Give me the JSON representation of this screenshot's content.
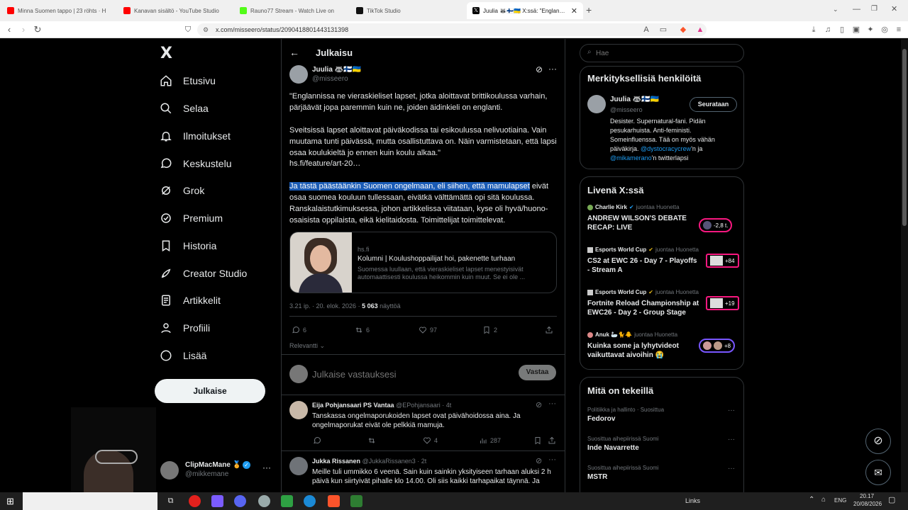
{
  "browser": {
    "tabs": [
      {
        "title": "Minna Suomen tappo | 23 röhts · H",
        "favicon_color": "#ff0000",
        "active": false
      },
      {
        "title": "Kanavan sisältö - YouTube Studio",
        "favicon_color": "#ff0000",
        "active": false
      },
      {
        "title": "Rauno77 Stream - Watch Live on",
        "favicon_color": "#53fc18",
        "active": false
      },
      {
        "title": "TikTok Studio",
        "favicon_color": "#111111",
        "active": false
      },
      {
        "title": "Juulia 🦝🇫🇮🇺🇦 X:ssä: \"Englanniss",
        "favicon_color": "#000000",
        "active": true
      }
    ],
    "new_tab": "+",
    "url": "x.com/misseero/status/2090418801443131398"
  },
  "nav": {
    "logo": "X",
    "items": [
      {
        "label": "Etusivu",
        "icon": "home-icon"
      },
      {
        "label": "Selaa",
        "icon": "search-icon"
      },
      {
        "label": "Ilmoitukset",
        "icon": "bell-icon"
      },
      {
        "label": "Keskustelu",
        "icon": "message-icon"
      },
      {
        "label": "Grok",
        "icon": "grok-icon"
      },
      {
        "label": "Premium",
        "icon": "verified-icon"
      },
      {
        "label": "Historia",
        "icon": "bookmark-icon"
      },
      {
        "label": "Creator Studio",
        "icon": "rocket-icon"
      },
      {
        "label": "Artikkelit",
        "icon": "article-icon"
      },
      {
        "label": "Profiili",
        "icon": "person-icon"
      },
      {
        "label": "Lisää",
        "icon": "more-icon"
      }
    ],
    "post_button": "Julkaise",
    "account": {
      "name": "ClipMacMane 🏅",
      "handle": "@mikkemane",
      "more": "···"
    }
  },
  "main": {
    "header": "Julkaisu",
    "tweet": {
      "name": "Juulia 🦝🇫🇮🇺🇦",
      "handle": "@misseero",
      "para1": "\"Englannissa ne vieraskieliset lapset, jotka aloittavat brittikoulussa varhain, pärjäävät jopa paremmin kuin ne, joiden äidinkieli on englanti.",
      "para2": "Sveitsissä lapset aloittavat päiväkodissa tai esikoulussa nelivuotiaina. Vain muutama tunti päivässä, mutta osallistuttava on. Näin varmistetaan, että lapsi osaa koulukieltä jo ennen kuin koulu alkaa.\"",
      "link": "hs.fi/feature/art-20…",
      "para3_highlight": "Ja tästä päästäänkin Suomen ongelmaan, eli siihen, että mamulapset",
      "para3_rest": " eivät osaa suomea kouluun tullessaan, eivätkä välttämättä opi sitä koulussa. Ranskalaistutkimuksessa, johon artikkelissa viitataan, kyse oli hyvä/huono-osaisista oppilaista, eikä kielitaidosta. Toimittelijat toimittelevat.",
      "card": {
        "domain": "hs.fi",
        "title": "Kolumni | Koulushoppailijat hoi, pakenette turhaan",
        "desc": "Suomessa luullaan, että vieraskieliset lapset menestyisivät automaattisesti koulussa heikommin kuin muut. Se ei ole ..."
      },
      "meta_time": "3.21 ip. · 20. elok. 2026 · ",
      "meta_views": "5 063",
      "meta_views_label": " näyttöä",
      "stats": {
        "replies": "6",
        "reposts": "6",
        "likes": "97",
        "bookmarks": "2"
      },
      "sort_label": "Relevantti"
    },
    "reply_box": {
      "placeholder": "Julkaise vastauksesi",
      "button": "Vastaa"
    },
    "replies": [
      {
        "name": "Eija Pohjansaari PS Vantaa",
        "handle": "@EPohjansaari",
        "time": "· 4t",
        "text": "Tanskassa ongelmaporukoiden lapset ovat päivähoidossa aina. Ja ongelmaporukat eivät ole pelkkiä mamuja.",
        "likes": "4",
        "views": "287"
      },
      {
        "name": "Jukka Rissanen",
        "handle": "@JukkaRissanen3",
        "time": "· 2t",
        "text": "Meille tuli ummikko 6 veenä. Sain kuin sainkin yksityiseen tarhaan aluksi 2 h päivä kun siirtyivät pihalle klo 14.00. Oli siis kaikki tarhapaikat täynnä. Ja"
      }
    ]
  },
  "sidebar": {
    "search_placeholder": "Hae",
    "relevant": {
      "title": "Merkityksellisiä henkilöitä",
      "name": "Juulia 🦝🇫🇮🇺🇦",
      "handle": "@misseero",
      "follow": "Seurataan",
      "bio1": "Desister. Supernatural-fani. Pidän pesukarhuista. Anti-feministi. Someinfluenssa. Tää on myös vähän päiväkirja. ",
      "bio_link1": "@dystocracycrew",
      "bio2": "'n ja ",
      "bio_link2": "@mikamerano",
      "bio3": "'n twitterlapsi"
    },
    "live": {
      "title": "Livenä X:ssä",
      "items": [
        {
          "host": "Charlie Kirk",
          "action": "juontaa Huonetta",
          "title": "ANDREW WILSON'S DEBATE RECAP: LIVE",
          "count": "-2,8 t."
        },
        {
          "host": "Esports World Cup",
          "action": "juontaa Huonetta",
          "title": "CS2 at EWC 26 - Day 7 - Playoffs - Stream A",
          "count": "+84"
        },
        {
          "host": "Esports World Cup",
          "action": "juontaa Huonetta",
          "title": "Fortnite Reload Championship at EWC26 - Day 2 - Group Stage",
          "count": "+19"
        },
        {
          "host": "Anuk 🦢🐈🐥",
          "action": "juontaa Huonetta",
          "title": "Kuinka some ja lyhytvideot vaikuttavat aivoihin 😭",
          "count": "+8"
        }
      ]
    },
    "happening": {
      "title": "Mitä on tekeillä",
      "items": [
        {
          "meta": "Politiikka ja hallinto · Suosittua",
          "title": "Fedorov"
        },
        {
          "meta": "Suosittua aihepiirissä Suomi",
          "title": "Inde Navarrette"
        },
        {
          "meta": "Suosittua aihepiirissä Suomi",
          "title": "MSTR"
        }
      ]
    }
  },
  "taskbar": {
    "links": "Links",
    "lang": "ENG",
    "time": "20.17",
    "date": "20/08/2026"
  }
}
